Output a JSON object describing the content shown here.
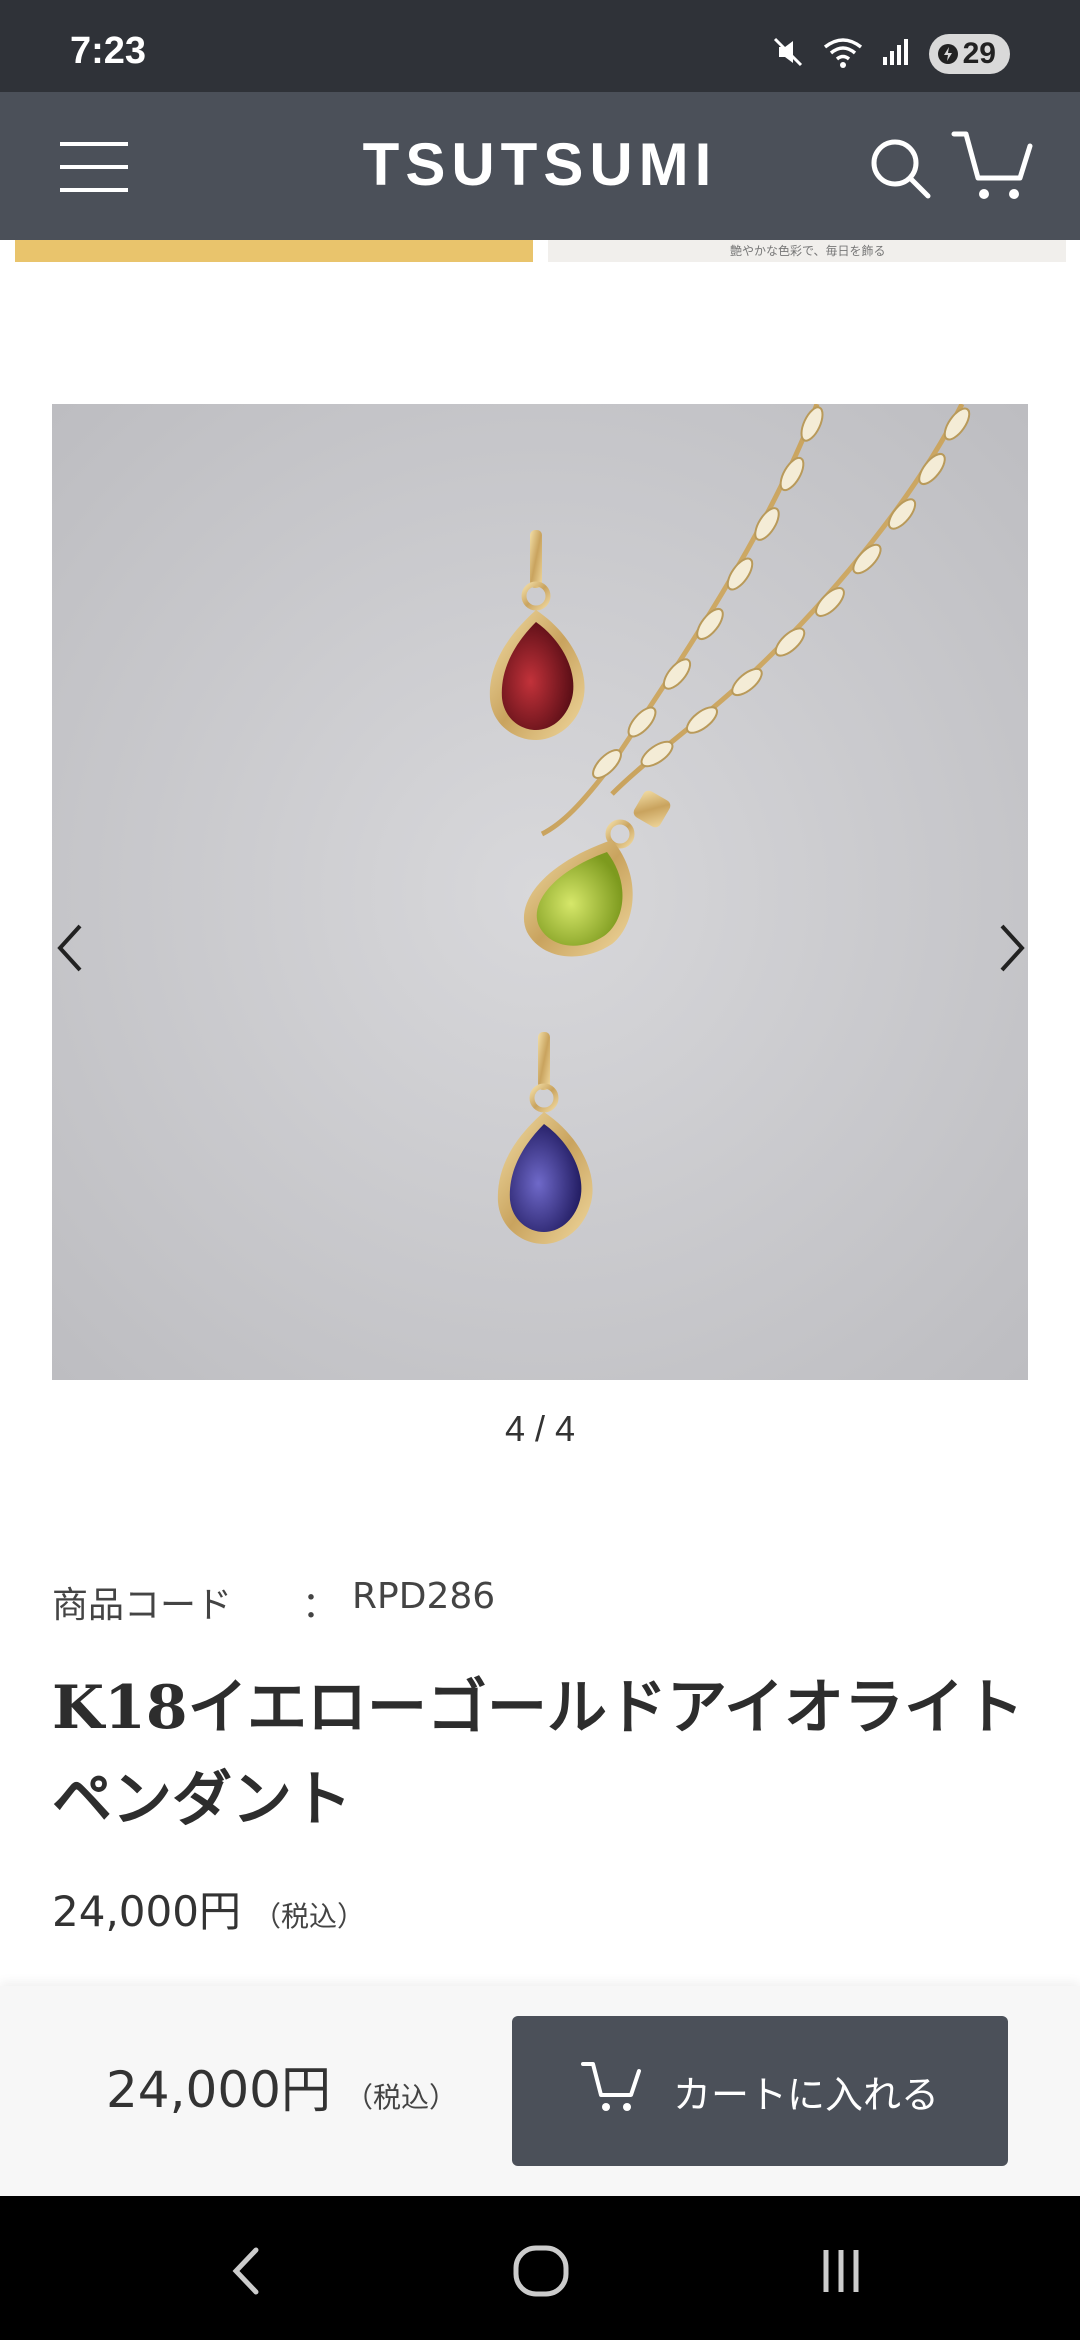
{
  "status_bar": {
    "time": "7:23",
    "battery": "29",
    "icons": [
      "mute-icon",
      "wifi-icon",
      "signal-icon",
      "battery-icon"
    ]
  },
  "header": {
    "brand": "TSUTSUMI",
    "color": "#4b5059",
    "icons": [
      "menu-icon",
      "search-icon",
      "cart-icon"
    ]
  },
  "banner": {
    "right_text": "艶やかな色彩で、毎日を飾る"
  },
  "gallery": {
    "pager": "4 / 4",
    "prev_icon": "chevron-left-icon",
    "next_icon": "chevron-right-icon",
    "stones": [
      "garnet",
      "peridot",
      "iolite"
    ]
  },
  "product": {
    "code_label": "商品コード",
    "code_sep": "：",
    "code_value": "RPD286",
    "title": "K18イエローゴールドアイオライトペンダント",
    "price": "24,000円",
    "tax": "（税込）"
  },
  "purchase_bar": {
    "price": "24,000円",
    "tax": "（税込）",
    "add_to_cart": "カートに入れる"
  },
  "nav_bar": {
    "icons": [
      "back-icon",
      "home-icon",
      "recents-icon"
    ]
  },
  "colors": {
    "accent": "#4b5059",
    "banner_gold": "#e9c46c"
  }
}
